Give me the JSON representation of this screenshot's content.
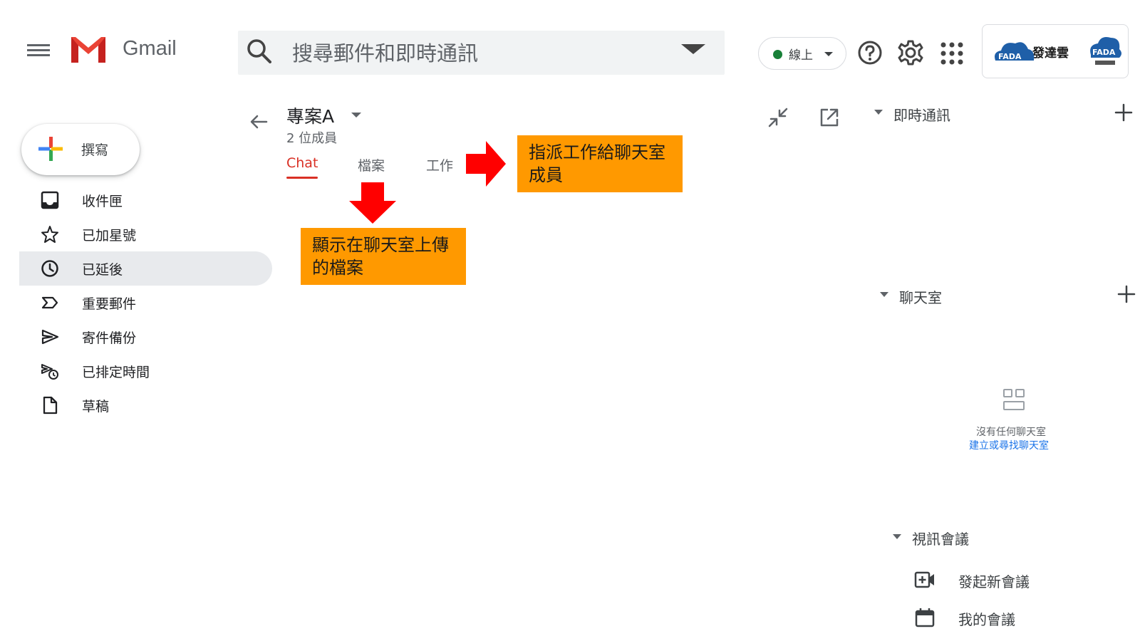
{
  "header": {
    "app_name": "Gmail",
    "search_placeholder": "搜尋郵件和即時通訊",
    "status_label": "線上",
    "account_brand": "發達雲"
  },
  "compose": {
    "label": "撰寫"
  },
  "nav": {
    "items": [
      {
        "label": "收件匣",
        "icon": "inbox-icon"
      },
      {
        "label": "已加星號",
        "icon": "star-icon"
      },
      {
        "label": "已延後",
        "icon": "clock-icon",
        "active": true
      },
      {
        "label": "重要郵件",
        "icon": "important-icon"
      },
      {
        "label": "寄件備份",
        "icon": "send-icon"
      },
      {
        "label": "已排定時間",
        "icon": "scheduled-send-icon"
      },
      {
        "label": "草稿",
        "icon": "draft-icon"
      }
    ]
  },
  "room": {
    "title": "專案A",
    "members": "2 位成員",
    "tabs": [
      {
        "label": "Chat",
        "active": true
      },
      {
        "label": "檔案"
      },
      {
        "label": "工作"
      }
    ]
  },
  "annotations": {
    "tasks_note": "指派工作給聊天室成員",
    "files_note": "顯示在聊天室上傳的檔案",
    "color": "#ff9900"
  },
  "side_panel": {
    "chat_title": "即時通訊",
    "rooms_title": "聊天室",
    "rooms_empty": "沒有任何聊天室",
    "rooms_link": "建立或尋找聊天室",
    "meet_title": "視訊會議",
    "meet_new": "發起新會議",
    "meet_mine": "我的會議"
  }
}
